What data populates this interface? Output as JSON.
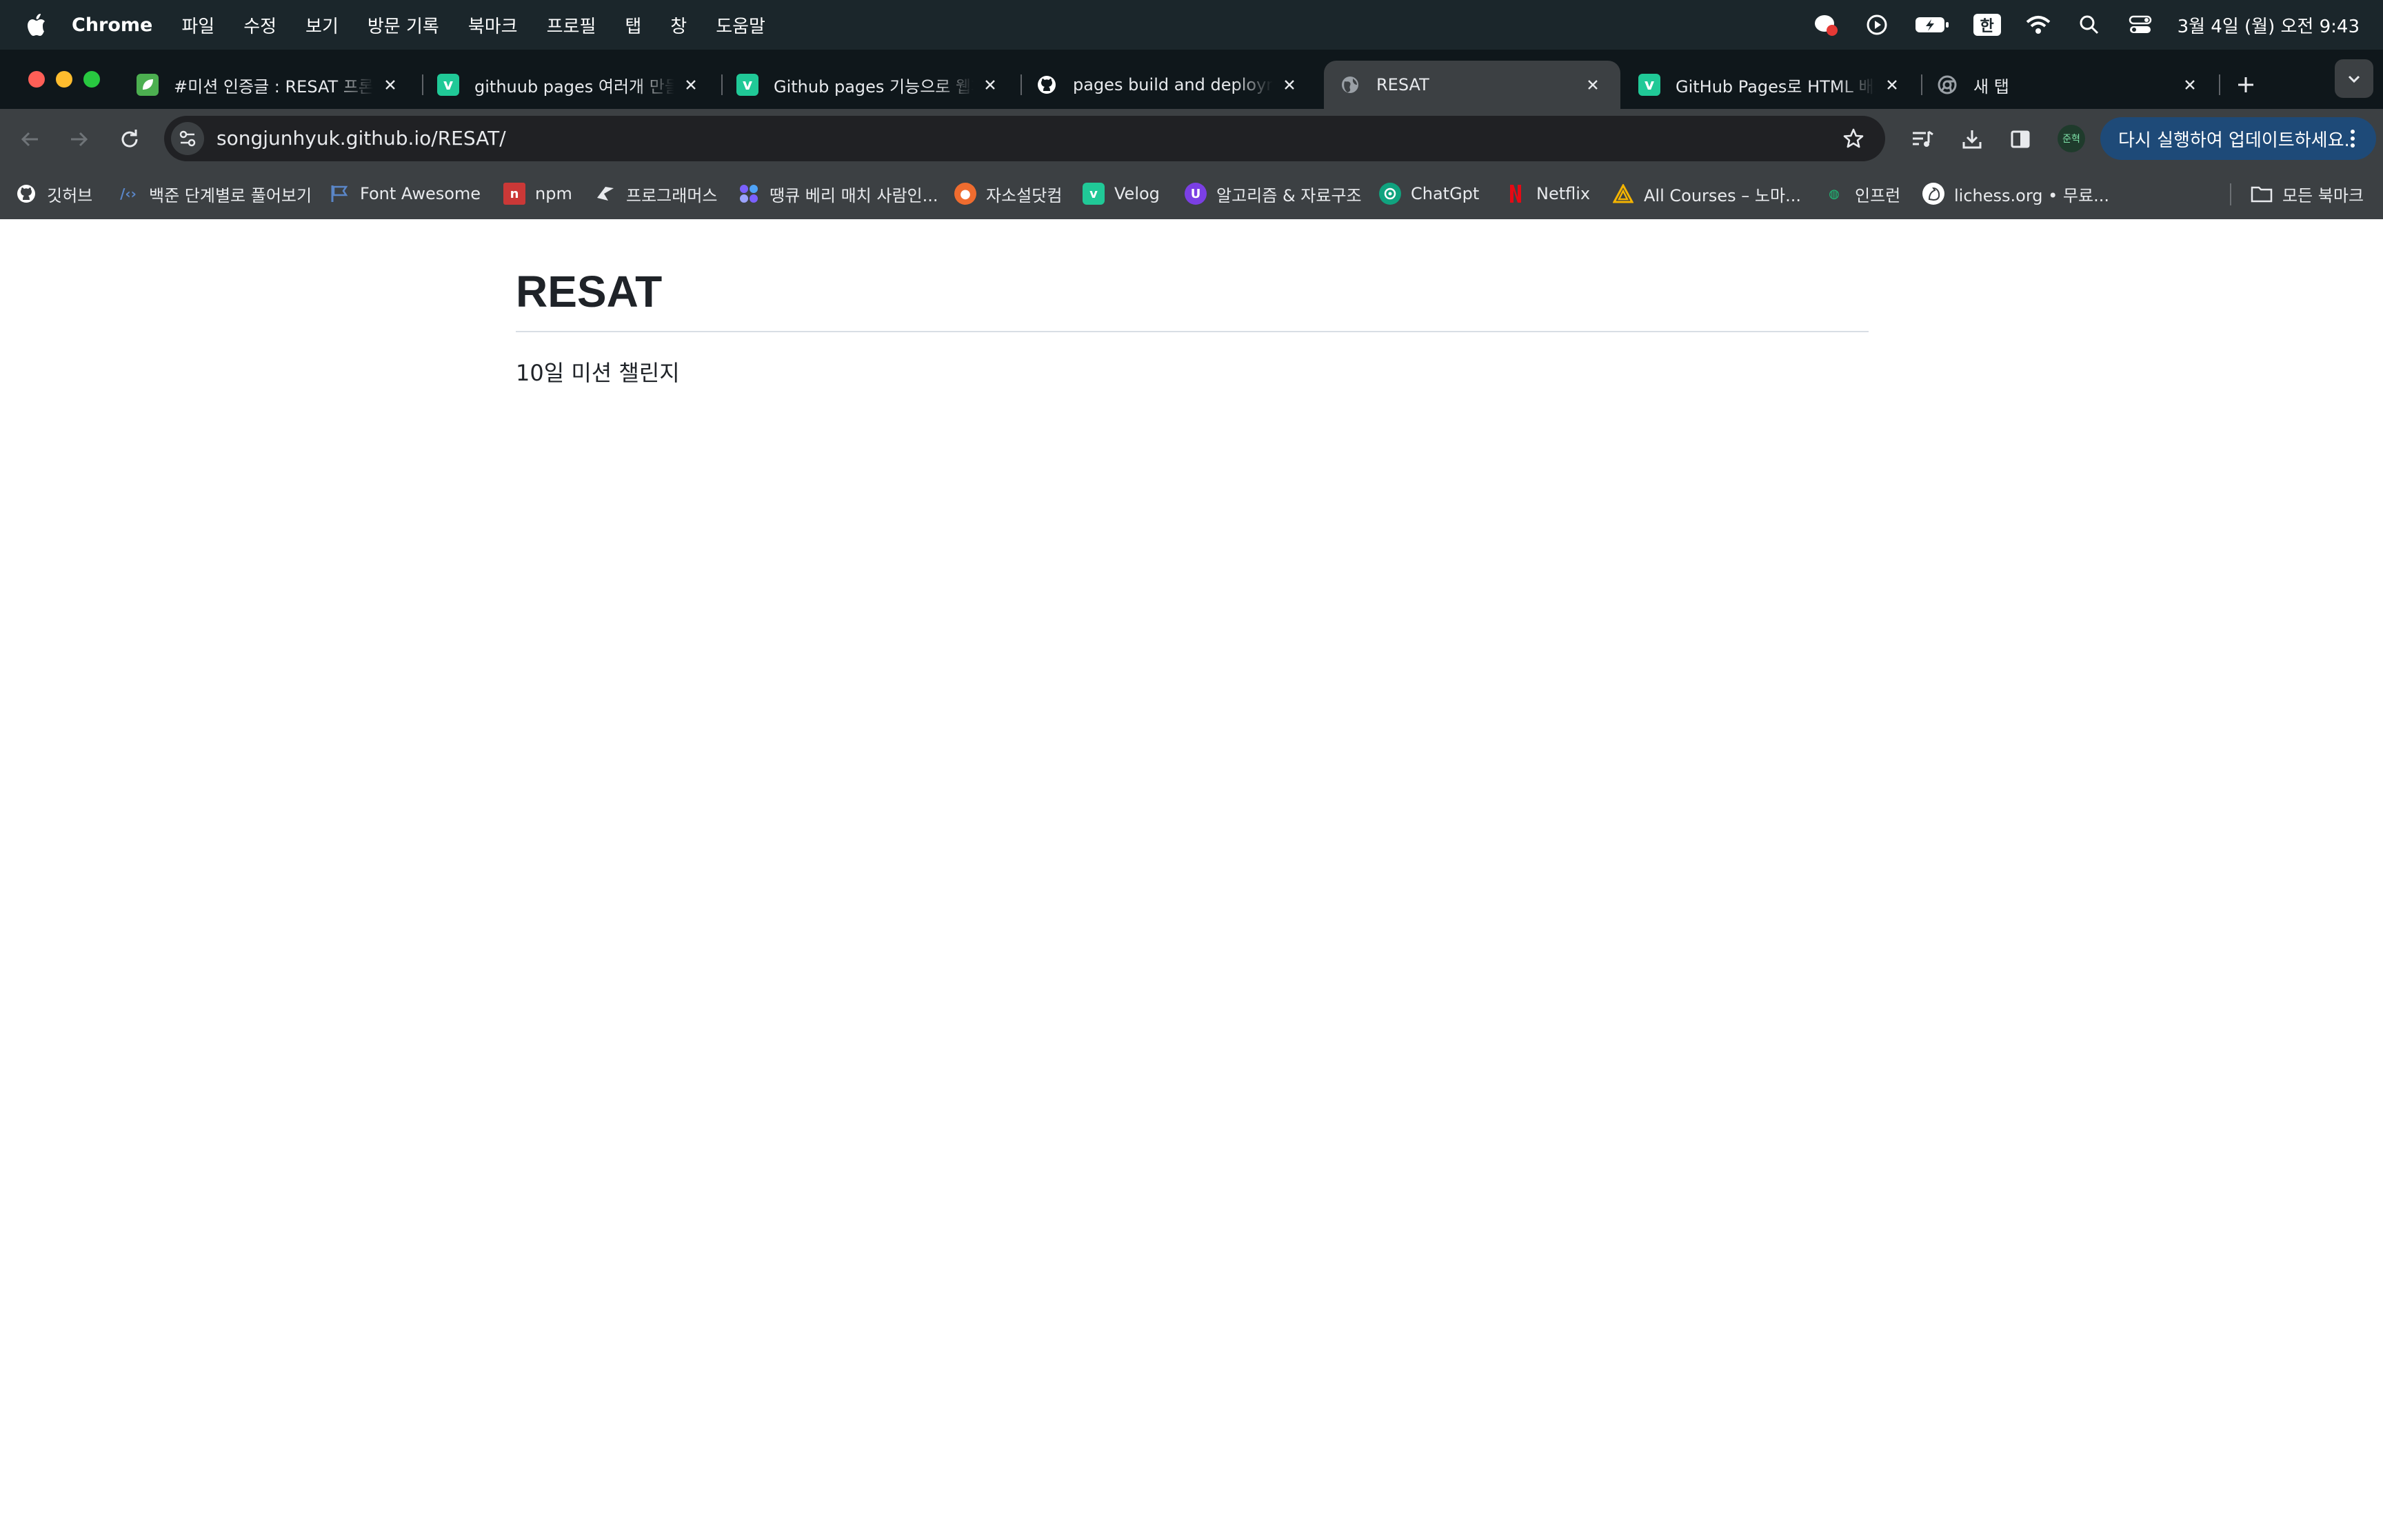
{
  "menubar": {
    "app_name": "Chrome",
    "items": [
      "파일",
      "수정",
      "보기",
      "방문 기록",
      "북마크",
      "프로필",
      "탭",
      "창",
      "도움말"
    ],
    "ime": "한",
    "clock": "3월 4일 (월) 오전 9:43"
  },
  "tabs": [
    {
      "title": "#미션 인증글 : RESAT 프론트",
      "icon": "leaf-icon",
      "icon_color": "#4caf50",
      "active": false
    },
    {
      "title": "githuub pages 여러개 만들기",
      "icon": "velog-icon",
      "icon_color": "#20c997",
      "active": false
    },
    {
      "title": "Github pages 기능으로 웹페이지",
      "icon": "velog-icon",
      "icon_color": "#20c997",
      "active": false
    },
    {
      "title": "pages build and deployment",
      "icon": "github-icon",
      "icon_color": "#ffffff",
      "active": false
    },
    {
      "title": "RESAT",
      "icon": "globe-icon",
      "icon_color": "#9aa0a6",
      "active": true
    },
    {
      "title": "GitHub Pages로 HTML 배포",
      "icon": "velog-icon",
      "icon_color": "#20c997",
      "active": false
    },
    {
      "title": "새 탭",
      "icon": "chrome-icon",
      "icon_color": "#9aa0a6",
      "active": false
    }
  ],
  "toolbar": {
    "url": "songjunhyuk.github.io/RESAT/",
    "profile_label": "준혁",
    "update_label": "다시 실행하여 업데이트하세요."
  },
  "bookmarks": [
    {
      "label": "깃허브",
      "icon": "github-icon"
    },
    {
      "label": "백준 단계별로 풀어보기",
      "icon": "code-icon"
    },
    {
      "label": "Font Awesome",
      "icon": "flag-icon"
    },
    {
      "label": "npm",
      "icon": "npm-icon"
    },
    {
      "label": "프로그래머스",
      "icon": "programmers-icon"
    },
    {
      "label": "땡큐 베리 매치 사람인...",
      "icon": "saramin-icon"
    },
    {
      "label": "자소설닷컴",
      "icon": "jasoseol-icon"
    },
    {
      "label": "Velog",
      "icon": "velog-icon"
    },
    {
      "label": "알고리즘 & 자료구조",
      "icon": "algorithm-icon"
    },
    {
      "label": "ChatGpt",
      "icon": "chatgpt-icon"
    },
    {
      "label": "Netflix",
      "icon": "netflix-icon"
    },
    {
      "label": "All Courses – 노마...",
      "icon": "nomad-icon"
    },
    {
      "label": "인프런",
      "icon": "inflearn-icon"
    },
    {
      "label": "lichess.org • 무료...",
      "icon": "lichess-icon"
    },
    {
      "label": "모든 북마크",
      "icon": "folder-icon"
    }
  ],
  "page": {
    "heading": "RESAT",
    "text": "10일 미션 챌린지"
  },
  "colors": {
    "menubar_bg": "#1b262b",
    "tabstrip_bg": "#0f171b",
    "toolbar_bg": "#3c4043",
    "update_btn_bg": "#1e4a78"
  }
}
